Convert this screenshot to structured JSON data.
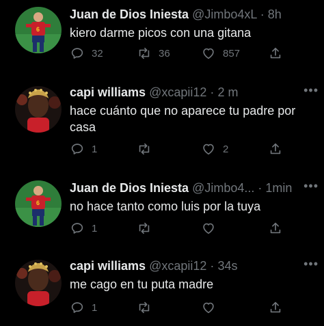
{
  "tweets": [
    {
      "name": "Juan de Dios Iniesta",
      "handle": "@Jimbo4xL",
      "time": "8h",
      "text": "kiero darme picos con una gitana",
      "replies": "32",
      "retweets": "36",
      "likes": "857"
    },
    {
      "name": "capi williams",
      "handle": "@xcapii12",
      "time": "2 m",
      "text": "hace cuánto que no aparece tu padre por casa",
      "replies": "1",
      "retweets": "",
      "likes": "2"
    },
    {
      "name": "Juan de Dios Iniesta",
      "handle": "@Jimbo4...",
      "time": "1min",
      "text": "no hace tanto como luis por la tuya",
      "replies": "1",
      "retweets": "",
      "likes": ""
    },
    {
      "name": "capi williams",
      "handle": "@xcapii12",
      "time": "34s",
      "text": "me cago en tu puta madre",
      "replies": "1",
      "retweets": "",
      "likes": ""
    }
  ],
  "separator": "·",
  "icons": {
    "reply": "reply-icon",
    "retweet": "retweet-icon",
    "like": "heart-icon",
    "share": "share-icon",
    "more": "more-icon"
  },
  "colors": {
    "background": "#000000",
    "text": "#e7e9ea",
    "muted": "#71767b"
  }
}
